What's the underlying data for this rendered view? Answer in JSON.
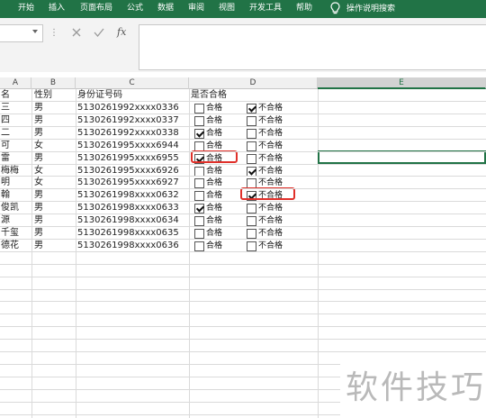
{
  "ribbon": {
    "tabs": [
      "开始",
      "插入",
      "页面布局",
      "公式",
      "数据",
      "审阅",
      "视图",
      "开发工具",
      "帮助"
    ],
    "tell_me": "操作说明搜索"
  },
  "formula_bar": {
    "name_box": "",
    "formula": "",
    "fx": "fx"
  },
  "columns": [
    "A",
    "B",
    "C",
    "D",
    "E"
  ],
  "headers": {
    "name": "名",
    "gender": "性别",
    "id": "身份证号码",
    "qualified": "是否合格"
  },
  "checkbox_labels": {
    "pass": "合格",
    "fail": "不合格"
  },
  "rows": [
    {
      "name": "三",
      "gender": "男",
      "id": "5130261992xxxx0336",
      "pass": false,
      "fail": true
    },
    {
      "name": "四",
      "gender": "男",
      "id": "5130261992xxxx0337",
      "pass": false,
      "fail": false
    },
    {
      "name": "二",
      "gender": "男",
      "id": "5130261992xxxx0338",
      "pass": true,
      "fail": false
    },
    {
      "name": "可",
      "gender": "女",
      "id": "5130261995xxxx6944",
      "pass": false,
      "fail": false
    },
    {
      "name": "雷",
      "gender": "男",
      "id": "5130261995xxxx6955",
      "pass": true,
      "fail": false
    },
    {
      "name": "梅梅",
      "gender": "女",
      "id": "5130261995xxxx6926",
      "pass": false,
      "fail": true
    },
    {
      "name": "明",
      "gender": "女",
      "id": "5130261995xxxx6927",
      "pass": false,
      "fail": false
    },
    {
      "name": "翰",
      "gender": "男",
      "id": "5130261998xxxx0632",
      "pass": false,
      "fail": true
    },
    {
      "name": "俊凯",
      "gender": "男",
      "id": "5130261998xxxx0633",
      "pass": true,
      "fail": false
    },
    {
      "name": "源",
      "gender": "男",
      "id": "5130261998xxxx0634",
      "pass": false,
      "fail": false
    },
    {
      "name": "千玺",
      "gender": "男",
      "id": "5130261998xxxx0635",
      "pass": false,
      "fail": false
    },
    {
      "name": "德花",
      "gender": "男",
      "id": "5130261998xxxx0636",
      "pass": false,
      "fail": false
    }
  ],
  "watermark": "软件技巧",
  "colors": {
    "ribbon": "#217346",
    "highlight": "#e0302a",
    "selection": "#217346"
  }
}
